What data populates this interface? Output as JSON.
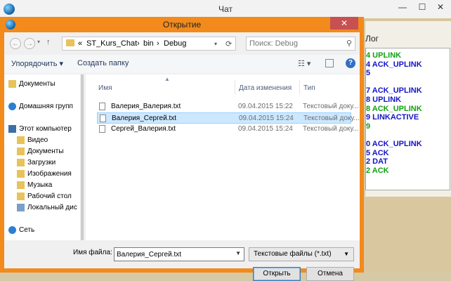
{
  "main_window": {
    "title": "Чат",
    "minimize": "—",
    "maximize": "☐",
    "close": "✕",
    "log_label": "Лог",
    "log_lines": [
      {
        "text": "4 UPLINK",
        "color": "#10a010"
      },
      {
        "text": "4 ACK_UPLINK",
        "color": "#1414c8"
      },
      {
        "text": "5",
        "color": "#1414c8"
      },
      {
        "text": "",
        "color": "#1414c8"
      },
      {
        "text": "7 ACK_UPLINK",
        "color": "#1414c8"
      },
      {
        "text": "8 UPLINK",
        "color": "#1414c8"
      },
      {
        "text": "8 ACK_UPLINK",
        "color": "#10a010"
      },
      {
        "text": "9 LINKACTIVE",
        "color": "#1414c8"
      },
      {
        "text": "9",
        "color": "#10a010"
      },
      {
        "text": "",
        "color": "#1414c8"
      },
      {
        "text": "0 ACK_UPLINK",
        "color": "#1414c8"
      },
      {
        "text": "5 ACK",
        "color": "#1414c8"
      },
      {
        "text": "2 DAT",
        "color": "#1414c8"
      },
      {
        "text": "2 ACK",
        "color": "#10a010"
      }
    ]
  },
  "dialog": {
    "title": "Открытие",
    "close": "✕",
    "back": "←",
    "forward": "→",
    "up": "↑",
    "breadcrumb": [
      "«",
      "ST_Kurs_Chat",
      "›",
      "bin",
      "›",
      "Debug"
    ],
    "address_dropdown": "▾",
    "refresh": "⟳",
    "search_placeholder": "Поиск: Debug",
    "toolbar": {
      "organize": "Упорядочить ▾",
      "new_folder": "Создать папку",
      "help": "?"
    },
    "nav": [
      {
        "label": "Документы",
        "icon": "folder-icon"
      },
      {
        "label": "Домашняя групп",
        "icon": "homegroup-icon"
      },
      {
        "label": "Этот компьютер",
        "icon": "computer-icon"
      },
      {
        "label": "Видео",
        "icon": "folder-icon"
      },
      {
        "label": "Документы",
        "icon": "folder-icon"
      },
      {
        "label": "Загрузки",
        "icon": "folder-icon"
      },
      {
        "label": "Изображения",
        "icon": "folder-icon"
      },
      {
        "label": "Музыка",
        "icon": "folder-icon"
      },
      {
        "label": "Рабочий стол",
        "icon": "folder-icon"
      },
      {
        "label": "Локальный дис",
        "icon": "drive-icon"
      },
      {
        "label": "Сеть",
        "icon": "network-icon"
      }
    ],
    "columns": {
      "name": "Имя",
      "date": "Дата изменения",
      "type": "Тип"
    },
    "files": [
      {
        "name": "Валерия_Валерия.txt",
        "date": "09.04.2015 15:22",
        "type": "Текстовый доку...",
        "selected": false
      },
      {
        "name": "Валерия_Сергей.txt",
        "date": "09.04.2015 15:24",
        "type": "Текстовый доку...",
        "selected": true
      },
      {
        "name": "Сергей_Валерия.txt",
        "date": "09.04.2015 15:24",
        "type": "Текстовый доку...",
        "selected": false
      }
    ],
    "filename_label": "Имя файла:",
    "filename_value": "Валерия_Сергей.txt",
    "filetype": "Текстовые файлы (*.txt)",
    "open_button": "Открыть",
    "cancel_button": "Отмена"
  }
}
